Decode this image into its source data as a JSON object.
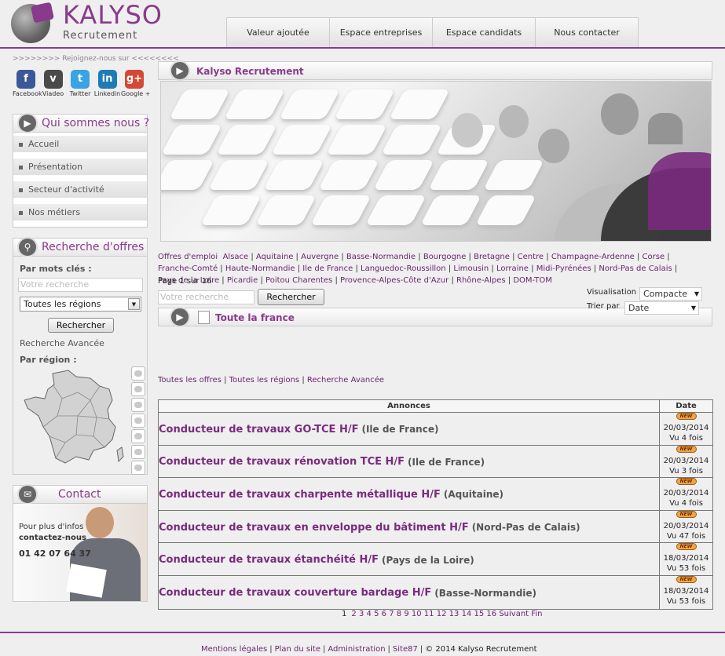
{
  "brand": {
    "name": "KALYSO",
    "subtitle": "Recrutement"
  },
  "nav": [
    "Valeur ajoutée",
    "Espace entreprises",
    "Espace candidats",
    "Nous contacter"
  ],
  "social": {
    "title": ">>>>>>>> Rejoignez-nous sur <<<<<<<<",
    "items": [
      {
        "label": "Facebook",
        "icon": "facebook-icon",
        "glyph": "f",
        "color": "#3b5998"
      },
      {
        "label": "Viadeo",
        "icon": "viadeo-icon",
        "glyph": "v",
        "color": "#4a4a4a"
      },
      {
        "label": "Twitter",
        "icon": "twitter-icon",
        "glyph": "t",
        "color": "#3aa3e3"
      },
      {
        "label": "Linkedin",
        "icon": "linkedin-icon",
        "glyph": "in",
        "color": "#1f7bb6"
      },
      {
        "label": "Google +",
        "icon": "googleplus-icon",
        "glyph": "g+",
        "color": "#d34836"
      }
    ]
  },
  "qui": {
    "title": "Qui sommes nous ?",
    "items": [
      "Accueil",
      "Présentation",
      "Secteur d'activité",
      "Nos métiers"
    ]
  },
  "recherche": {
    "title": "Recherche d'offres",
    "keywords_label": "Par mots clés :",
    "placeholder": "Votre recherche",
    "region_select": "Toutes les régions",
    "button": "Rechercher",
    "advanced": "Recherche Avancée",
    "region_label": "Par région :"
  },
  "contact": {
    "title": "Contact",
    "line1": "Pour plus d'infos",
    "line2": "contactez-nous",
    "phone": "01 42 07 64 37"
  },
  "main": {
    "title": "Kalyso Recrutement",
    "regions_label": "Offres d'emploi",
    "regions": [
      "Alsace",
      "Aquitaine",
      "Auvergne",
      "Basse-Normandie",
      "Bourgogne",
      "Bretagne",
      "Centre",
      "Champagne-Ardenne",
      "Corse",
      "Franche-Comté",
      "Haute-Normandie",
      "Ile de France",
      "Languedoc-Roussillon",
      "Limousin",
      "Lorraine",
      "Midi-Pyrénées",
      "Nord-Pas de Calais",
      "Pays de la Loire",
      "Picardie",
      "Poitou Charentes",
      "Provence-Alpes-Côte d'Azur",
      "Rhône-Alpes",
      "DOM-TOM"
    ],
    "section_title": "Toute la france",
    "page_info": "Page 1 sur 16",
    "search_placeholder": "Votre recherche",
    "search_button": "Rechercher",
    "visualisation_label": "Visualisation",
    "visualisation_value": "Compacte",
    "trier_label": "Trier par",
    "trier_value": "Date",
    "filters": [
      "Toutes les offres",
      "Toutes les régions",
      "Recherche Avancée"
    ]
  },
  "table": {
    "col_annonces": "Annonces",
    "col_date": "Date",
    "badge": "NEW",
    "rows": [
      {
        "title": "Conducteur de travaux GO-TCE H/F",
        "location": "(Ile de France)",
        "date": "20/03/2014",
        "views": "Vu 4 fois"
      },
      {
        "title": "Conducteur de travaux rénovation TCE H/F",
        "location": "(Ile de France)",
        "date": "20/03/2014",
        "views": "Vu 3 fois"
      },
      {
        "title": "Conducteur de travaux charpente métallique H/F",
        "location": "(Aquitaine)",
        "date": "20/03/2014",
        "views": "Vu 4 fois"
      },
      {
        "title": "Conducteur de travaux en enveloppe du bâtiment H/F",
        "location": "(Nord-Pas de Calais)",
        "date": "20/03/2014",
        "views": "Vu 47 fois"
      },
      {
        "title": "Conducteur de travaux étanchéité H/F",
        "location": "(Pays de la Loire)",
        "date": "18/03/2014",
        "views": "Vu 53 fois"
      },
      {
        "title": "Conducteur de travaux couverture bardage H/F",
        "location": "(Basse-Normandie)",
        "date": "18/03/2014",
        "views": "Vu 53 fois"
      }
    ]
  },
  "pager": {
    "current": "1",
    "pages": [
      "2",
      "3",
      "4",
      "5",
      "6",
      "7",
      "8",
      "9",
      "10",
      "11",
      "12",
      "13",
      "14",
      "15",
      "16"
    ],
    "next": "Suivant",
    "last": "Fin"
  },
  "footer": {
    "links": [
      "Mentions légales",
      "Plan du site",
      "Administration",
      "Site87"
    ],
    "copyright": "© 2014 Kalyso Recrutement"
  },
  "colors": {
    "accent": "#8a3a8d",
    "link": "#6b2470"
  }
}
